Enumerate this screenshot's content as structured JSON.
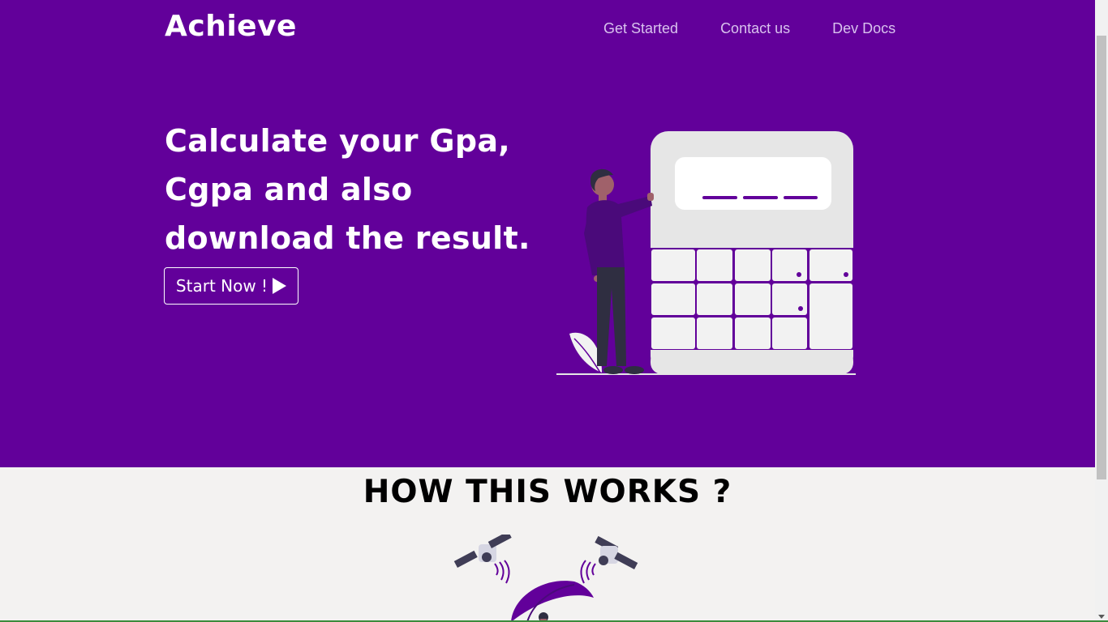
{
  "brand": {
    "name": "Achieve"
  },
  "nav": {
    "items": [
      {
        "label": "Get Started"
      },
      {
        "label": "Contact us"
      },
      {
        "label": "Dev Docs"
      }
    ]
  },
  "hero": {
    "headline": "Calculate your Gpa, Cgpa and also download the result.",
    "cta_label": "Start Now !",
    "cta_icon": "play-icon"
  },
  "how": {
    "title": "HOW THIS WORKS ?"
  },
  "colors": {
    "primary": "#62009a",
    "nav_text": "#d9c2ee",
    "section_bg": "#f3f2f1",
    "calculator_body": "#e6e6e6",
    "calculator_key": "#f2f2f2",
    "person_skin": "#a0616a",
    "person_hair": "#2f2e41"
  }
}
